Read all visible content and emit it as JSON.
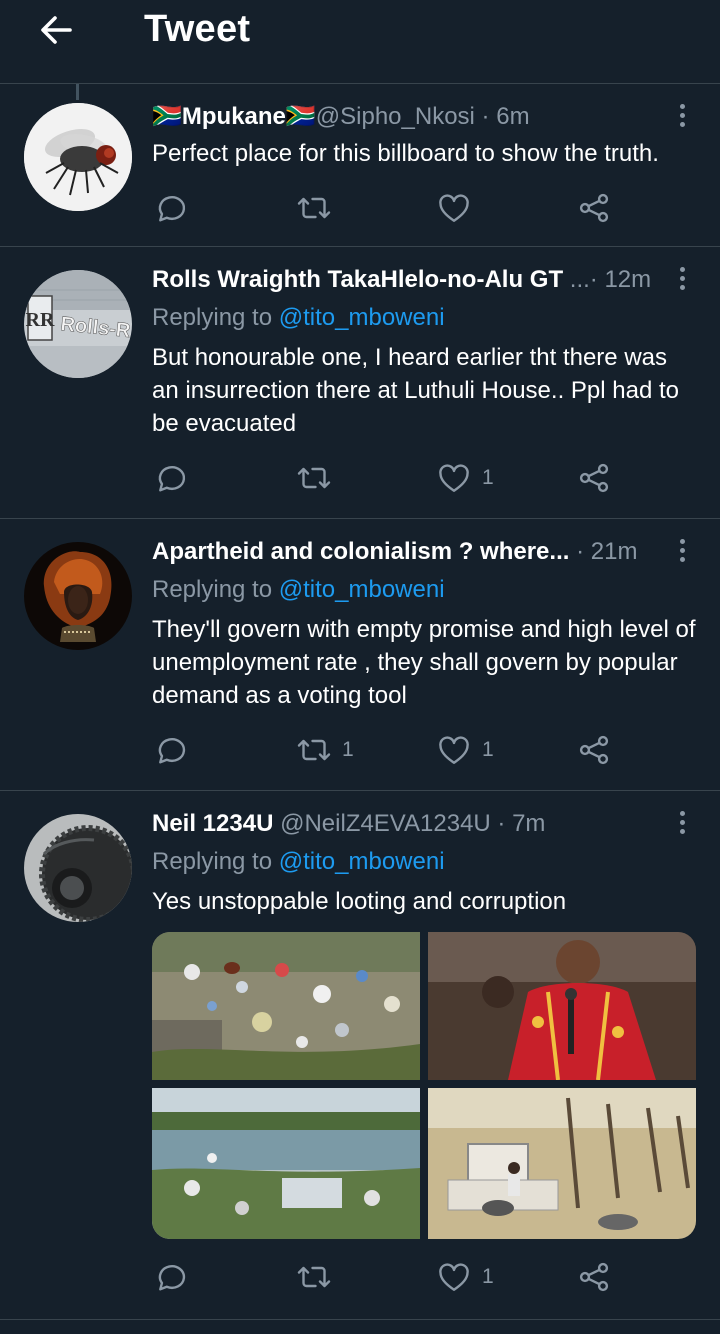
{
  "header": {
    "title": "Tweet",
    "back_icon": "arrow-left-icon"
  },
  "colors": {
    "background": "#15202b",
    "divider": "#38444d",
    "muted": "#8b98a5",
    "link": "#1d9bf0"
  },
  "tweets": [
    {
      "name": "🇿🇦Mpukane🇿🇦",
      "meta": "@Sipho_Nkosi · 6m",
      "reply_prefix": "",
      "reply_handle": "",
      "text": "Perfect place for this billboard to show the truth.",
      "avatar": "fly-avatar",
      "counts": {
        "reply": "",
        "retweet": "",
        "like": ""
      }
    },
    {
      "name": "Rolls Wraighth TakaHlelo-no-Alu GT",
      "meta": " ...· 12m",
      "reply_prefix": "Replying to ",
      "reply_handle": "@tito_mboweni",
      "text": "But honourable one, I heard earlier tht there was an insurrection there at Luthuli House.. Ppl had to be evacuated",
      "avatar": "rolls-royce-avatar",
      "counts": {
        "reply": "",
        "retweet": "",
        "like": "1"
      }
    },
    {
      "name": "Apartheid and colonialism ? where...",
      "meta": " · 21m",
      "reply_prefix": "Replying to ",
      "reply_handle": "@tito_mboweni",
      "text": "They'll govern with empty promise and high level of unemployment rate , they shall govern by popular demand as a voting tool",
      "avatar": "lion-headdress-avatar",
      "counts": {
        "reply": "",
        "retweet": "1",
        "like": "1"
      }
    },
    {
      "name": "Neil 1234U",
      "meta": " @NeilZ4EVA1234U · 7m",
      "reply_prefix": "Replying to ",
      "reply_handle": "@tito_mboweni",
      "text": "Yes unstoppable looting and corruption",
      "avatar": "tyre-avatar",
      "media": [
        "litter-dumpsite-photo",
        "man-in-red-robe-photo",
        "polluted-river-photo",
        "toilets-in-field-photo"
      ],
      "counts": {
        "reply": "",
        "retweet": "",
        "like": "1"
      }
    }
  ]
}
